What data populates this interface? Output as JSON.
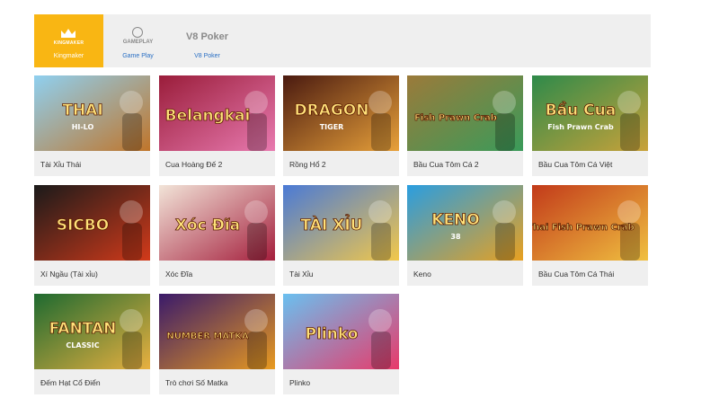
{
  "providers": [
    {
      "label": "Kingmaker",
      "logo_text": "KINGMAKER",
      "active": true
    },
    {
      "label": "Game Play",
      "logo_text": "GAMEPLAY",
      "active": false
    },
    {
      "label": "V8 Poker",
      "logo_text": "V8 Poker",
      "active": false
    }
  ],
  "games": [
    {
      "title": "Tài Xỉu Thái",
      "art": "THAI",
      "sub": "HI-LO",
      "colors": [
        "#8fd0f0",
        "#c0752a"
      ]
    },
    {
      "title": "Cua Hoàng Đế 2",
      "art": "Belangkai",
      "sub": "",
      "colors": [
        "#9a1d3a",
        "#e87ab0"
      ]
    },
    {
      "title": "Rồng Hổ 2",
      "art": "DRAGON",
      "sub": "TIGER",
      "colors": [
        "#4a1a10",
        "#e8a13a"
      ]
    },
    {
      "title": "Bầu Cua Tôm Cá 2",
      "art": "Fish Prawn Crab",
      "sub": "",
      "colors": [
        "#9b7a3a",
        "#3a9b5a"
      ]
    },
    {
      "title": "Bầu Cua Tôm Cá Việt",
      "art": "Bầu Cua",
      "sub": "Fish Prawn Crab",
      "colors": [
        "#2e8a4a",
        "#c9a23a"
      ]
    },
    {
      "title": "Xí Ngầu (Tài xỉu)",
      "art": "SICBO",
      "sub": "",
      "colors": [
        "#1a1a1a",
        "#d23a1a"
      ]
    },
    {
      "title": "Xóc Đĩa",
      "art": "Xóc Đĩa",
      "sub": "",
      "colors": [
        "#f2e4d8",
        "#a41e3c"
      ]
    },
    {
      "title": "Tài Xỉu",
      "art": "TÀI XỈU",
      "sub": "",
      "colors": [
        "#4a7ad6",
        "#f2c84a"
      ]
    },
    {
      "title": "Keno",
      "art": "KENO",
      "sub": "38",
      "colors": [
        "#2a9ee0",
        "#e8a020"
      ]
    },
    {
      "title": "Bầu Cua Tôm Cá Thái",
      "art": "Thai Fish Prawn Crab",
      "sub": "",
      "colors": [
        "#c23a1a",
        "#f0c040"
      ]
    },
    {
      "title": "Đếm Hạt Cổ Điển",
      "art": "FANTAN",
      "sub": "CLASSIC",
      "colors": [
        "#1e6a30",
        "#e8b040"
      ]
    },
    {
      "title": "Trò chơi Số Matka",
      "art": "NUMBER MATKA",
      "sub": "",
      "colors": [
        "#3a1a6a",
        "#e89a20"
      ]
    },
    {
      "title": "Plinko",
      "art": "Plinko",
      "sub": "",
      "colors": [
        "#6ac0f0",
        "#e83a6a"
      ]
    }
  ]
}
